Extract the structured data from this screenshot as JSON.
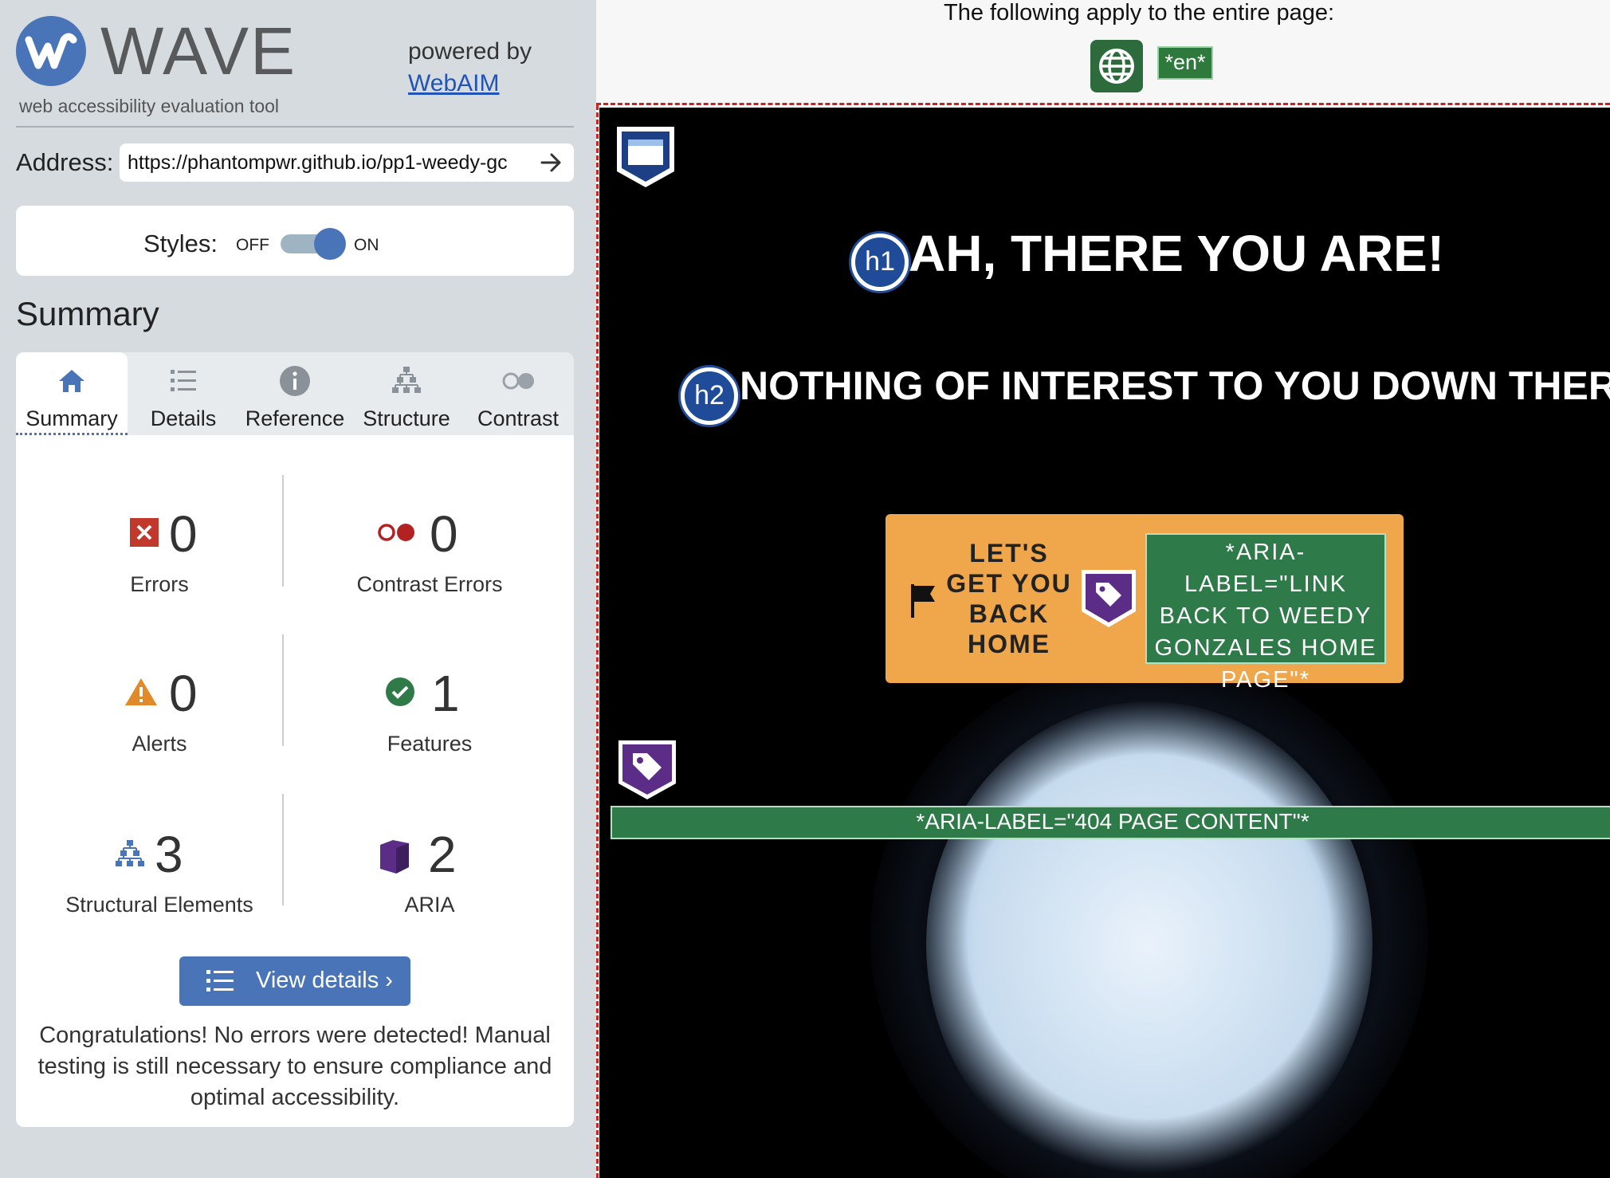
{
  "sidebar": {
    "logo_word": "WAVE",
    "tagline": "web accessibility evaluation tool",
    "powered_by": "powered by",
    "powered_link": "WebAIM",
    "address_label": "Address:",
    "address_value": "https://phantompwr.github.io/pp1-weedy-gc",
    "styles_label": "Styles:",
    "styles_off": "OFF",
    "styles_on": "ON",
    "styles_enabled": true,
    "summary_heading": "Summary",
    "tabs": [
      {
        "label": "Summary",
        "icon": "home-icon",
        "active": true
      },
      {
        "label": "Details",
        "icon": "list-icon",
        "active": false
      },
      {
        "label": "Reference",
        "icon": "info-icon",
        "active": false
      },
      {
        "label": "Structure",
        "icon": "structure-icon",
        "active": false
      },
      {
        "label": "Contrast",
        "icon": "contrast-icon",
        "active": false
      }
    ],
    "stats": {
      "errors": {
        "count": "0",
        "label": "Errors",
        "icon": "error-icon",
        "color": "#c0392b"
      },
      "contrast_errors": {
        "count": "0",
        "label": "Contrast Errors",
        "icon": "contrast-error-icon",
        "color": "#b22222"
      },
      "alerts": {
        "count": "0",
        "label": "Alerts",
        "icon": "alert-icon",
        "color": "#e08a2a"
      },
      "features": {
        "count": "1",
        "label": "Features",
        "icon": "feature-check-icon",
        "color": "#2f7a48"
      },
      "structural": {
        "count": "3",
        "label": "Structural Elements",
        "icon": "structure-icon",
        "color": "#4a74b8"
      },
      "aria": {
        "count": "2",
        "label": "ARIA",
        "icon": "aria-cube-icon",
        "color": "#5b2d86"
      }
    },
    "view_details": "View details ›",
    "congrats": "Congratulations! No errors were detected! Manual testing is still necessary to ensure compliance and optimal accessibility."
  },
  "page": {
    "apply_text": "The following apply to the entire page:",
    "lang_badge": "*en*",
    "h1_badge": "h1",
    "h1_text": "AH, THERE YOU ARE!",
    "h2_badge": "h2",
    "h2_text": "NOTHING OF INTEREST TO YOU DOWN THERE.",
    "cta_text": "LET'S GET YOU BACK HOME",
    "cta_aria": "*ARIA-LABEL=\"LINK BACK TO WEEDY GONZALES HOME PAGE\"*",
    "section_aria": "*ARIA-LABEL=\"404 PAGE CONTENT\"*"
  },
  "colors": {
    "accent": "#4a74b8",
    "sidebar_bg": "#d6dbe0",
    "aria_green": "#2e7a48",
    "cta_orange": "#f0a64b"
  }
}
